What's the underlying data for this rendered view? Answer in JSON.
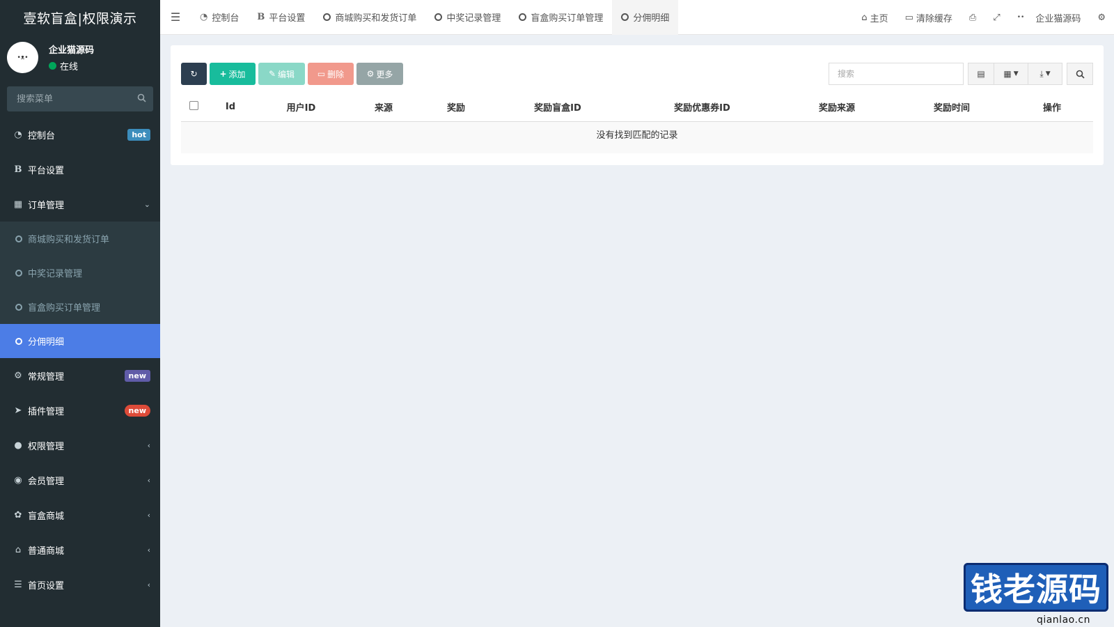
{
  "app": {
    "title": "壹软盲盒|权限演示"
  },
  "user": {
    "avatar_text": "•ᴥ•",
    "name": "企业猫源码",
    "status": "在线"
  },
  "sidebar": {
    "search_placeholder": "搜索菜单",
    "items": [
      {
        "label": "控制台",
        "icon": "dashboard-icon",
        "badge": "hot"
      },
      {
        "label": "平台设置",
        "icon": "bold-icon"
      },
      {
        "label": "订单管理",
        "icon": "calculator-icon",
        "children": [
          {
            "label": "商城购买和发货订单"
          },
          {
            "label": "中奖记录管理"
          },
          {
            "label": "盲盒购买订单管理"
          },
          {
            "label": "分佣明细",
            "active": true
          }
        ]
      },
      {
        "label": "常规管理",
        "icon": "cogs-icon",
        "badge": "new"
      },
      {
        "label": "插件管理",
        "icon": "rocket-icon",
        "badge": "new"
      },
      {
        "label": "权限管理",
        "icon": "group-icon"
      },
      {
        "label": "会员管理",
        "icon": "user-circle-icon"
      },
      {
        "label": "盲盒商城",
        "icon": "leaf-icon"
      },
      {
        "label": "普通商城",
        "icon": "bank-icon"
      },
      {
        "label": "首页设置",
        "icon": "list-icon"
      }
    ]
  },
  "topbar": {
    "tabs": [
      {
        "label": "控制台",
        "icon": "dashboard-icon"
      },
      {
        "label": "平台设置",
        "icon": "bold-icon"
      },
      {
        "label": "商城购买和发货订单",
        "icon": "circle-icon"
      },
      {
        "label": "中奖记录管理",
        "icon": "circle-icon"
      },
      {
        "label": "盲盒购买订单管理",
        "icon": "circle-icon"
      },
      {
        "label": "分佣明细",
        "icon": "circle-icon",
        "active": true
      }
    ],
    "right": {
      "home": "主页",
      "clear_cache": "清除缓存",
      "user": "企业猫源码"
    }
  },
  "toolbar": {
    "add": "添加",
    "edit": "编辑",
    "delete": "删除",
    "more": "更多",
    "search_placeholder": "搜索"
  },
  "table": {
    "columns": [
      "Id",
      "用户ID",
      "来源",
      "奖励",
      "奖励盲盒ID",
      "奖励优惠券ID",
      "奖励来源",
      "奖励时间",
      "操作"
    ],
    "empty_text": "没有找到匹配的记录"
  },
  "watermark": {
    "text": "钱老源码",
    "url": "qianlao.cn"
  },
  "colors": {
    "sidebar_bg": "#222d32",
    "active": "#4c7de6",
    "add": "#18bc9c",
    "delete": "#f1998c",
    "hot": "#3c8dbc"
  }
}
